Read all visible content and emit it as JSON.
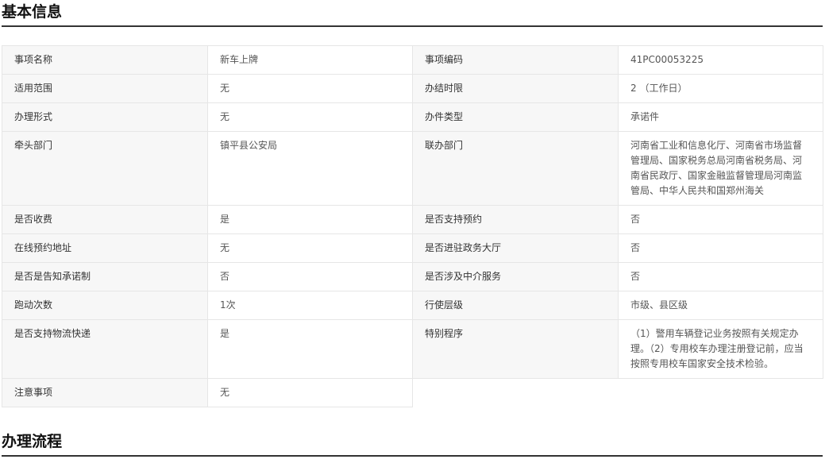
{
  "sections": {
    "basic_info_title": "基本信息",
    "process_title": "办理流程"
  },
  "rows": [
    [
      {
        "label": "事项名称",
        "value": "新车上牌"
      },
      {
        "label": "事项编码",
        "value": "41PC00053225"
      }
    ],
    [
      {
        "label": "适用范围",
        "value": "无"
      },
      {
        "label": "办结时限",
        "value": "2 （工作日）"
      }
    ],
    [
      {
        "label": "办理形式",
        "value": "无"
      },
      {
        "label": "办件类型",
        "value": "承诺件"
      }
    ],
    [
      {
        "label": "牵头部门",
        "value": "镇平县公安局"
      },
      {
        "label": "联办部门",
        "value": "河南省工业和信息化厅、河南省市场监督管理局、国家税务总局河南省税务局、河南省民政厅、国家金融监督管理局河南监管局、中华人民共和国郑州海关"
      }
    ],
    [
      {
        "label": "是否收费",
        "value": "是"
      },
      {
        "label": "是否支持预约",
        "value": "否"
      }
    ],
    [
      {
        "label": "在线预约地址",
        "value": "无"
      },
      {
        "label": "是否进驻政务大厅",
        "value": "否"
      }
    ],
    [
      {
        "label": "是否是告知承诺制",
        "value": "否"
      },
      {
        "label": "是否涉及中介服务",
        "value": "否"
      }
    ],
    [
      {
        "label": "跑动次数",
        "value": "1次"
      },
      {
        "label": "行使层级",
        "value": "市级、县区级"
      }
    ],
    [
      {
        "label": "是否支持物流快递",
        "value": "是"
      },
      {
        "label": "特别程序",
        "value": "（1）警用车辆登记业务按照有关规定办理。（2）专用校车办理注册登记前，应当按照专用校车国家安全技术检验。"
      }
    ],
    [
      {
        "label": "注意事项",
        "value": "无"
      }
    ]
  ]
}
